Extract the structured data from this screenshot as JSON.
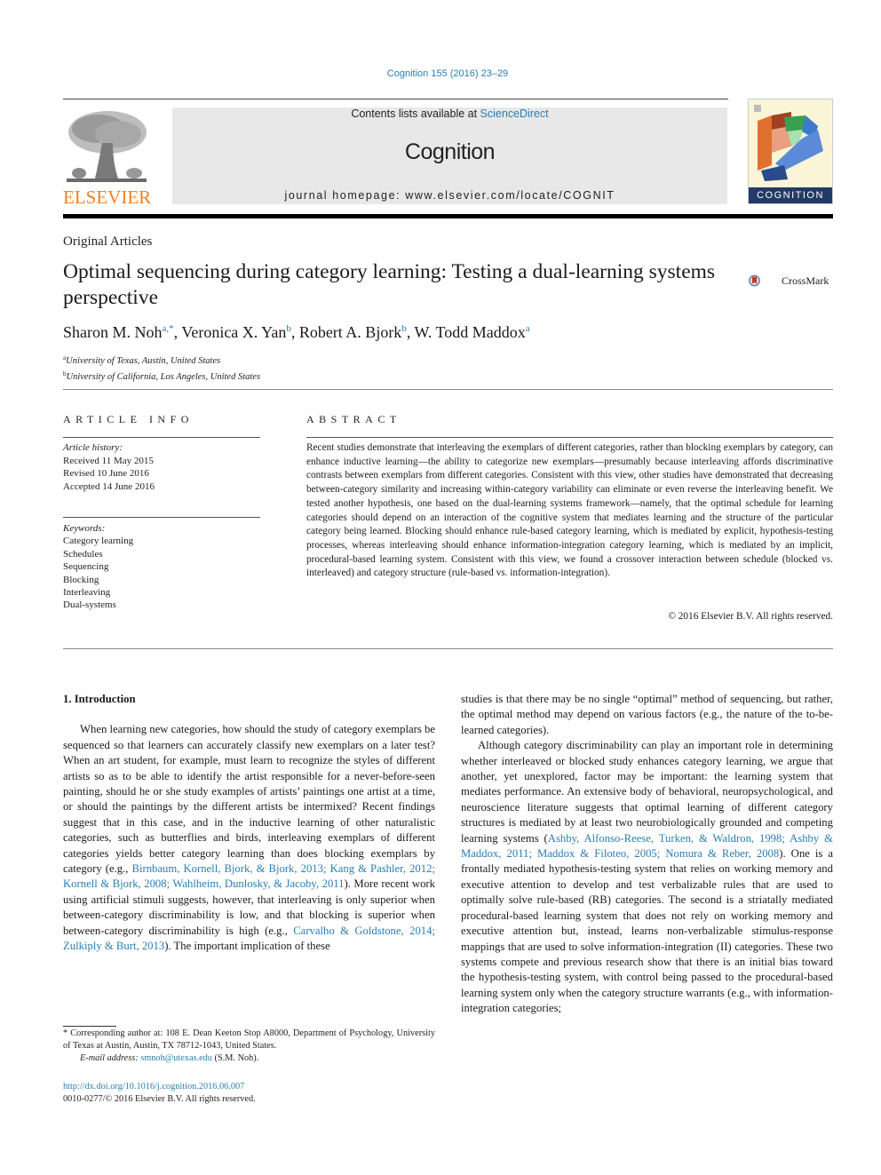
{
  "journal_citation": "Cognition 155 (2016) 23–29",
  "header": {
    "contents_prefix": "Contents lists available at ",
    "contents_link": "ScienceDirect",
    "journal_name": "Cognition",
    "homepage": "journal homepage: www.elsevier.com/locate/COGNIT",
    "publisher_logo_text": "ELSEVIER",
    "cover_text": "COGNITION"
  },
  "colors": {
    "link": "#2a7eb0",
    "elsevier_orange": "#f47f20",
    "header_gray": "#e8e8e8",
    "cover_navy": "#233a66"
  },
  "article": {
    "section_type": "Original Articles",
    "title": "Optimal sequencing during category learning: Testing a dual-learning systems perspective",
    "crossmark_label": "CrossMark",
    "authors": [
      {
        "name": "Sharon M. Noh",
        "sup": "a,*",
        "sep": ", "
      },
      {
        "name": "Veronica X. Yan",
        "sup": "b",
        "sep": ", "
      },
      {
        "name": "Robert A. Bjork",
        "sup": "b",
        "sep": ", "
      },
      {
        "name": "W. Todd Maddox",
        "sup": "a",
        "sep": ""
      }
    ],
    "affiliations": [
      {
        "sup": "a",
        "text": "University of Texas, Austin, United States"
      },
      {
        "sup": "b",
        "text": "University of California, Los Angeles, United States"
      }
    ]
  },
  "article_info": {
    "heading": "ARTICLE INFO",
    "history_label": "Article history:",
    "history": [
      "Received 11 May 2015",
      "Revised 10 June 2016",
      "Accepted 14 June 2016"
    ],
    "keywords_label": "Keywords:",
    "keywords": [
      "Category learning",
      "Schedules",
      "Sequencing",
      "Blocking",
      "Interleaving",
      "Dual-systems"
    ]
  },
  "abstract": {
    "heading": "ABSTRACT",
    "text": "Recent studies demonstrate that interleaving the exemplars of different categories, rather than blocking exemplars by category, can enhance inductive learning—the ability to categorize new exemplars—presumably because interleaving affords discriminative contrasts between exemplars from different categories. Consistent with this view, other studies have demonstrated that decreasing between-category similarity and increasing within-category variability can eliminate or even reverse the interleaving benefit. We tested another hypothesis, one based on the dual-learning systems framework—namely, that the optimal schedule for learning categories should depend on an interaction of the cognitive system that mediates learning and the structure of the particular category being learned. Blocking should enhance rule-based category learning, which is mediated by explicit, hypothesis-testing processes, whereas interleaving should enhance information-integration category learning, which is mediated by an implicit, procedural-based learning system. Consistent with this view, we found a crossover interaction between schedule (blocked vs. interleaved) and category structure (rule-based vs. information-integration).",
    "copyright": "© 2016 Elsevier B.V. All rights reserved."
  },
  "intro": {
    "heading": "1. Introduction",
    "left_p1_a": "When learning new categories, how should the study of category exemplars be sequenced so that learners can accurately classify new exemplars on a later test? When an art student, for example, must learn to recognize the styles of different artists so as to be able to identify the artist responsible for a never-before-seen painting, should he or she study examples of artists’ paintings one artist at a time, or should the paintings by the different artists be intermixed? Recent findings suggest that in this case, and in the inductive learning of other naturalistic categories, such as butterflies and birds, interleaving exemplars of different categories yields better category learning than does blocking exemplars by category (e.g., ",
    "left_cite1": "Birnbaum, Kornell, Bjork, & Bjork, 2013; Kang & Pashler, 2012; Kornell & Bjork, 2008; Wahlheim, Dunlosky, & Jacoby, 2011",
    "left_p1_b": "). More recent work using artificial stimuli suggests, however, that interleaving is only superior when between-category discriminability is low, and that blocking is superior when between-category discriminability is high (e.g., ",
    "left_cite2": "Carvalho & Goldstone, 2014; Zulkiply & Burt, 2013",
    "left_p1_c": "). The important implication of these",
    "right_p1": "studies is that there may be no single “optimal” method of sequencing, but rather, the optimal method may depend on various factors (e.g., the nature of the to-be-learned categories).",
    "right_p2_a": "Although category discriminability can play an important role in determining whether interleaved or blocked study enhances category learning, we argue that another, yet unexplored, factor may be important: the learning system that mediates performance. An extensive body of behavioral, neuropsychological, and neuroscience literature suggests that optimal learning of different category structures is mediated by at least two neurobiologically grounded and competing learning systems (",
    "right_cite1": "Ashby, Alfonso-Reese, Turken, & Waldron, 1998; Ashby & Maddox, 2011; Maddox & Filoteo, 2005; Nomura & Reber, 2008",
    "right_p2_b": "). One is a frontally mediated hypothesis-testing system that relies on working memory and executive attention to develop and test verbalizable rules that are used to optimally solve rule-based (RB) categories. The second is a striatally mediated procedural-based learning system that does not rely on working memory and executive attention but, instead, learns non-verbalizable stimulus-response mappings that are used to solve information-integration (II) categories. These two systems compete and previous research show that there is an initial bias toward the hypothesis-testing system, with control being passed to the procedural-based learning system only when the category structure warrants (e.g., with information-integration categories;"
  },
  "footnote": {
    "corresponding": "* Corresponding author at: 108 E. Dean Keeton Stop A8000, Department of Psychology, University of Texas at Austin, Austin, TX 78712-1043, United States.",
    "email_label": "E-mail address: ",
    "email": "smnoh@utexas.edu",
    "email_suffix": " (S.M. Noh).",
    "doi": "http://dx.doi.org/10.1016/j.cognition.2016.06.007",
    "issn_copyright": "0010-0277/© 2016 Elsevier B.V. All rights reserved."
  }
}
